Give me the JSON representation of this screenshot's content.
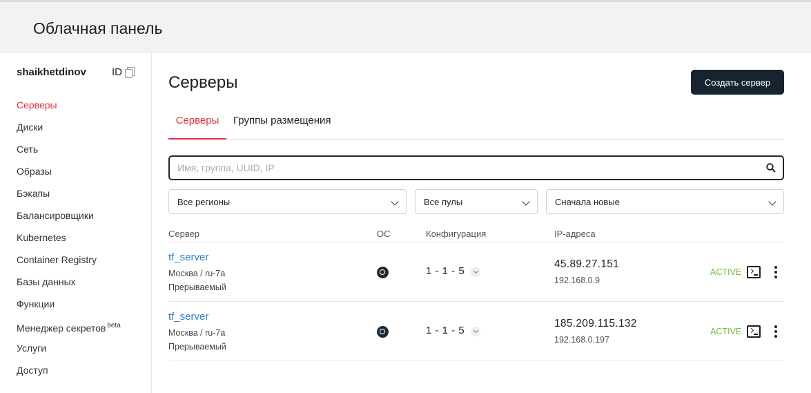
{
  "header": {
    "title": "Облачная панель"
  },
  "sidebar": {
    "username": "shaikhetdinov",
    "id_label": "ID",
    "items": [
      {
        "label": "Серверы",
        "active": true
      },
      {
        "label": "Диски"
      },
      {
        "label": "Сеть"
      },
      {
        "label": "Образы"
      },
      {
        "label": "Бэкапы"
      },
      {
        "label": "Балансировщики"
      },
      {
        "label": "Kubernetes"
      },
      {
        "label": "Container Registry"
      },
      {
        "label": "Базы данных"
      },
      {
        "label": "Функции"
      },
      {
        "label": "Менеджер секретов",
        "badge": "beta"
      },
      {
        "label": "Услуги"
      },
      {
        "label": "Доступ"
      }
    ]
  },
  "main": {
    "title": "Серверы",
    "create_button": "Создать сервер",
    "tabs": [
      {
        "label": "Серверы",
        "active": true
      },
      {
        "label": "Группы размещения"
      }
    ],
    "search": {
      "placeholder": "Имя, группа, UUID, IP",
      "value": ""
    },
    "filters": {
      "region": "Все регионы",
      "pool": "Все пулы",
      "sort": "Сначала новые"
    },
    "columns": {
      "server": "Сервер",
      "os": "ОС",
      "config": "Конфигурация",
      "ip": "IP-адреса"
    },
    "rows": [
      {
        "name": "tf_server",
        "location": "Москва / ru-7a",
        "type": "Прерываемый",
        "os_icon": "ubuntu-icon",
        "config": "1 - 1 - 5",
        "ip_public": "45.89.27.151",
        "ip_private": "192.168.0.9",
        "status": "ACTIVE"
      },
      {
        "name": "tf_server",
        "location": "Москва / ru-7a",
        "type": "Прерываемый",
        "os_icon": "ubuntu-icon",
        "config": "1 - 1 - 5",
        "ip_public": "185.209.115.132",
        "ip_private": "192.168.0.197",
        "status": "ACTIVE"
      }
    ]
  },
  "colors": {
    "accent": "#e0323c",
    "primary_button": "#152430",
    "link": "#2e7cd6",
    "status_active": "#6bbf3a"
  }
}
